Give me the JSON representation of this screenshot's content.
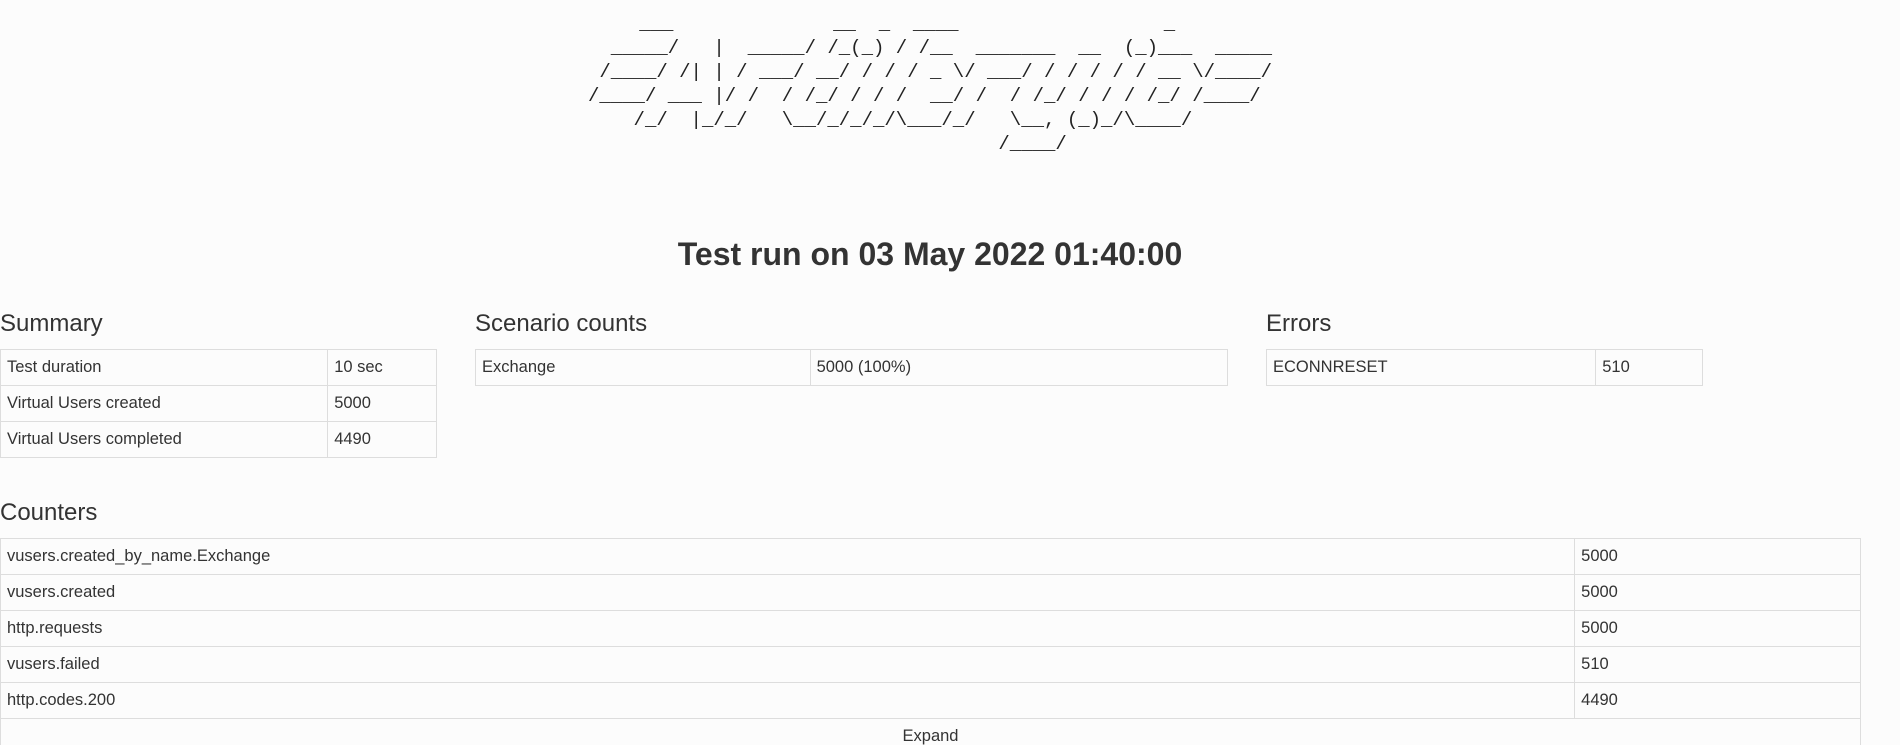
{
  "logo": {
    "ascii_lines": [
      "   ___              __  _  ____                  _       ",
      "  _____/   |  _____/ /_(_) / /__  _______  __  (_)___  _____",
      " /____/ /| | / ___/ __/ / / / _ \\/ ___/ / / / / / __ \\/____/",
      "/____/ ___ |/ /  / /_/ / / /  __/ /  / /_/ / / / /_/ /____/ ",
      "    /_/  |_/_/   \\__/_/_/_/\\___/_/   \\__, (_)_/\\____/       ",
      "                                    /____/                  "
    ]
  },
  "report": {
    "title": "Test run on 03 May 2022 01:40:00"
  },
  "summary": {
    "heading": "Summary",
    "rows": [
      {
        "label": "Test duration",
        "value": "10 sec"
      },
      {
        "label": "Virtual Users created",
        "value": "5000"
      },
      {
        "label": "Virtual Users completed",
        "value": "4490"
      }
    ]
  },
  "scenario_counts": {
    "heading": "Scenario counts",
    "rows": [
      {
        "label": "Exchange",
        "value": "5000 (100%)"
      }
    ]
  },
  "errors": {
    "heading": "Errors",
    "rows": [
      {
        "label": "ECONNRESET",
        "value": "510"
      }
    ]
  },
  "counters": {
    "heading": "Counters",
    "rows": [
      {
        "label": "vusers.created_by_name.Exchange",
        "value": "5000"
      },
      {
        "label": "vusers.created",
        "value": "5000"
      },
      {
        "label": "http.requests",
        "value": "5000"
      },
      {
        "label": "vusers.failed",
        "value": "510"
      },
      {
        "label": "http.codes.200",
        "value": "4490"
      }
    ],
    "expand_label": "Expand"
  },
  "colors": {
    "link": "#337ab7",
    "border": "#dddddd",
    "text": "#333333",
    "background": "#fcfcfc"
  }
}
